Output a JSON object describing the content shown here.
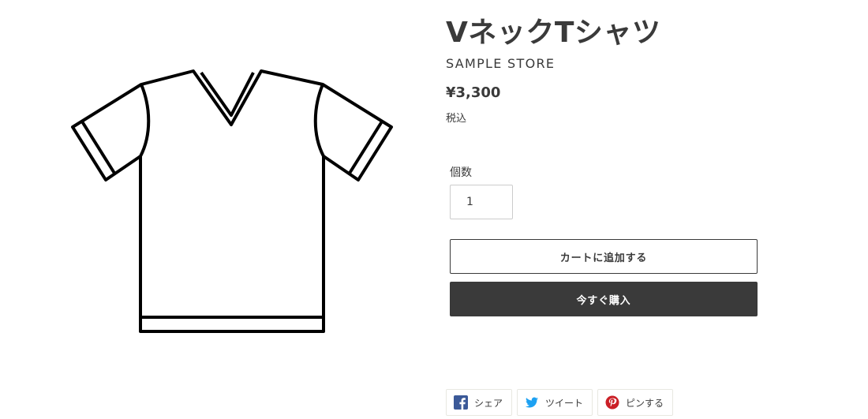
{
  "product": {
    "title": "VネックTシャツ",
    "vendor": "SAMPLE STORE",
    "price": "¥3,300",
    "tax_note": "税込",
    "image_icon": "v-neck-tshirt-illustration"
  },
  "quantity": {
    "label": "個数",
    "value": "1"
  },
  "buttons": {
    "add_to_cart": "カートに追加する",
    "buy_now": "今すぐ購入"
  },
  "share": {
    "facebook": {
      "label": "シェア",
      "icon": "facebook-icon",
      "color": "#3b5998"
    },
    "twitter": {
      "label": "ツイート",
      "icon": "twitter-icon",
      "color": "#1da1f2"
    },
    "pinterest": {
      "label": "ピンする",
      "icon": "pinterest-icon",
      "color": "#cb2027"
    }
  }
}
